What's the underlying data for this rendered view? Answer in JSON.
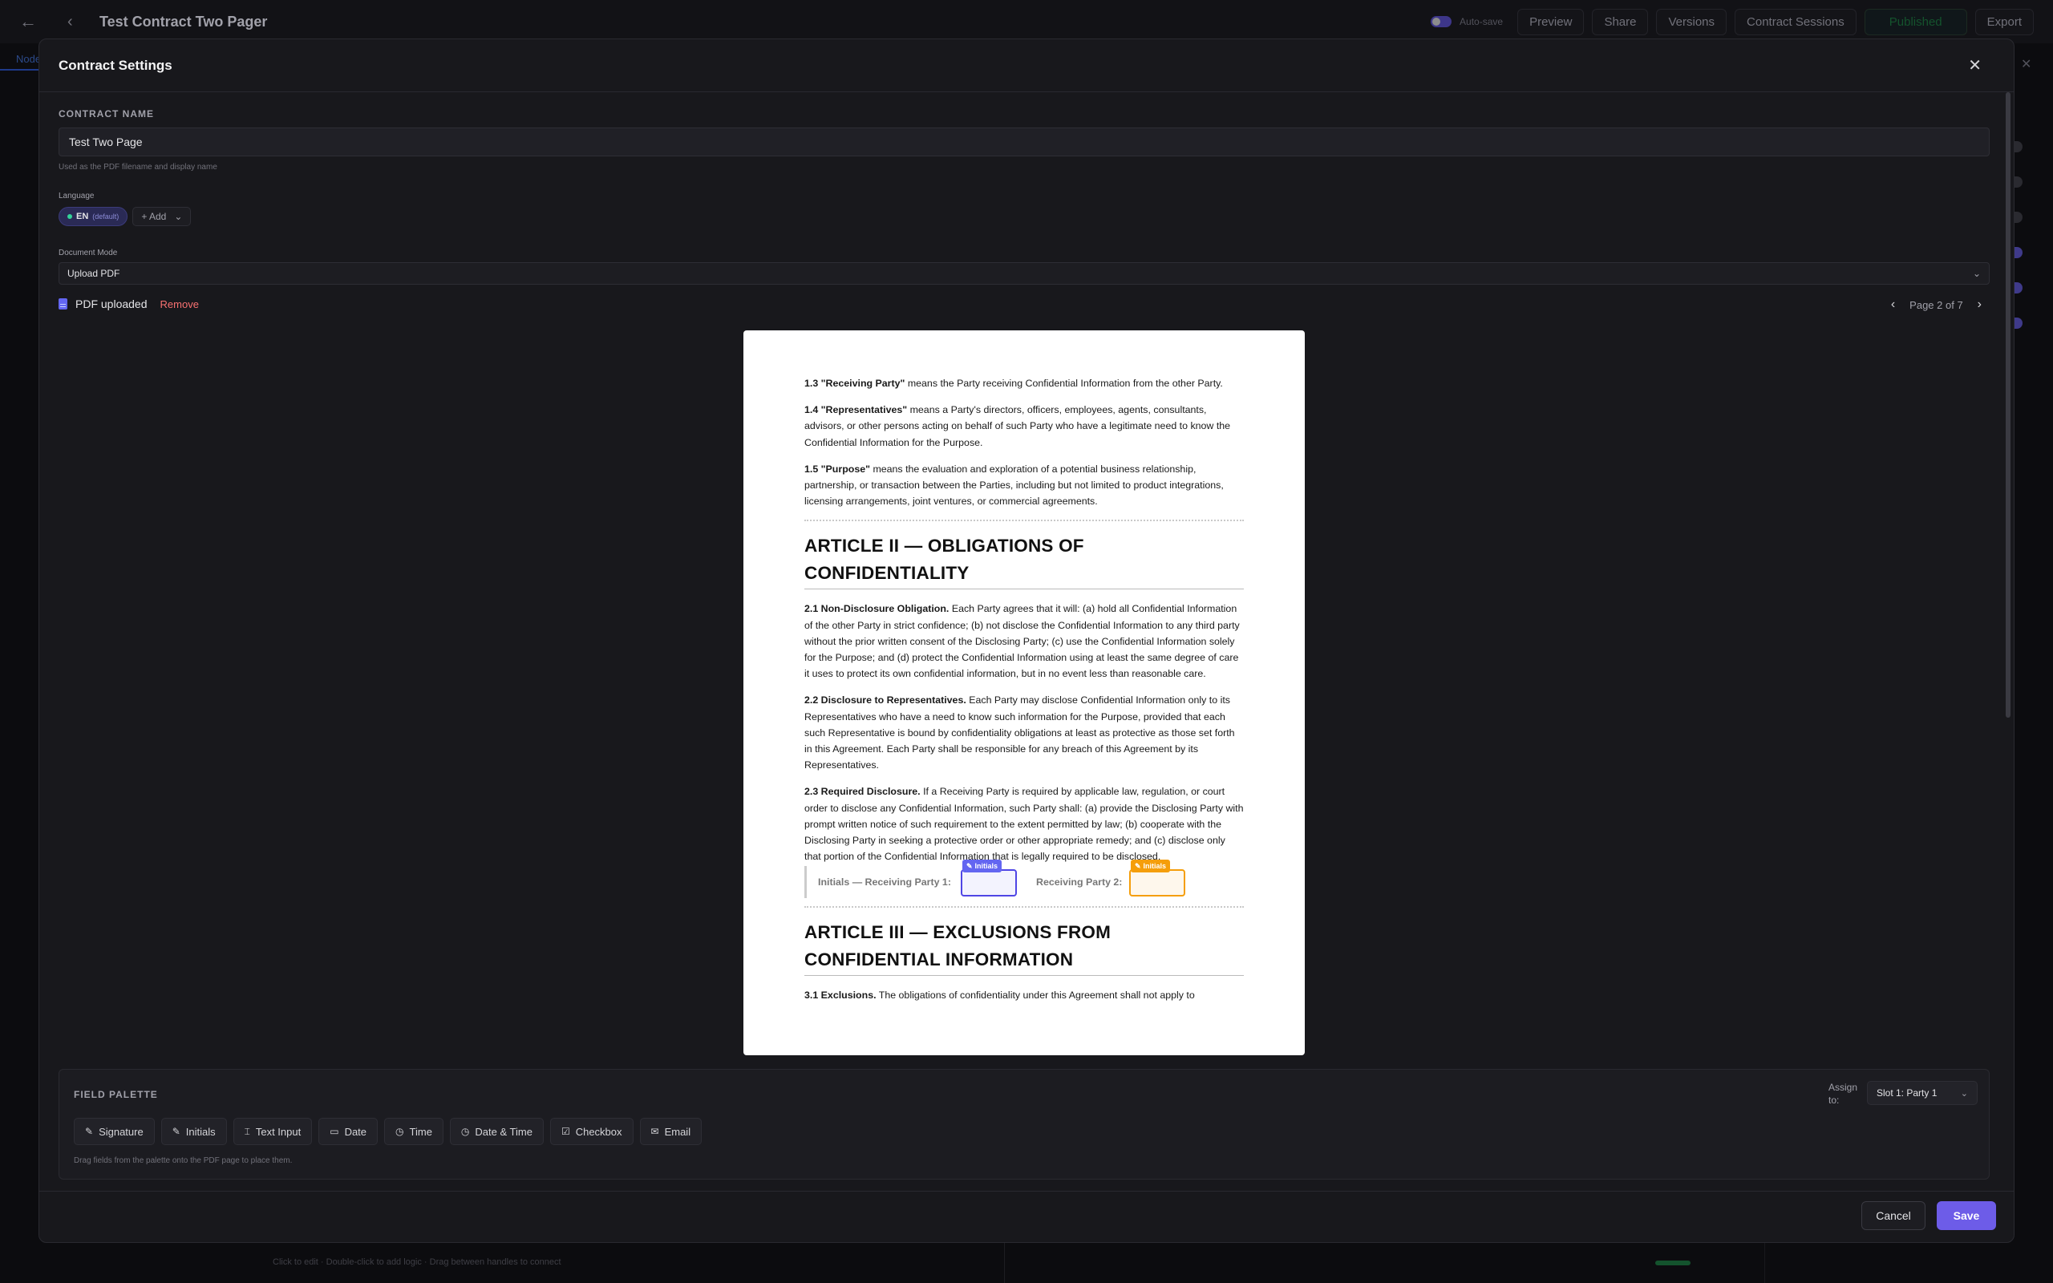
{
  "app": {
    "title": "Test Contract Two Pager",
    "autosave_label": "Auto-save",
    "toolbar": {
      "preview": "Preview",
      "share": "Share",
      "versions": "Versions",
      "contract_sessions": "Contract Sessions",
      "published": "Published",
      "export": "Export"
    },
    "bg_tab": "Node",
    "bg_hint": "Click to edit · Double-click to add logic · Drag between handles to connect"
  },
  "modal": {
    "title": "Contract Settings",
    "contract_name_label": "CONTRACT NAME",
    "contract_name_value": "Test Two Page",
    "contract_name_hint": "Used as the PDF filename and display name",
    "language_label": "Language",
    "language_chip": {
      "code": "EN",
      "default_label": "(default)"
    },
    "add_language": "+ Add",
    "document_mode_label": "Document Mode",
    "document_mode_value": "Upload PDF",
    "pdf_status": "PDF uploaded",
    "remove": "Remove",
    "pager": "Page 2 of 7",
    "cancel": "Cancel",
    "save": "Save"
  },
  "pdf_page": {
    "p13_term": "1.3 \"Receiving Party\"",
    "p13_text": " means the Party receiving Confidential Information from the other Party.",
    "p14_term": "1.4 \"Representatives\"",
    "p14_text": " means a Party's directors, officers, employees, agents, consultants, advisors, or other persons acting on behalf of such Party who have a legitimate need to know the Confidential Information for the Purpose.",
    "p15_term": "1.5 \"Purpose\"",
    "p15_text": " means the evaluation and exploration of a potential business relationship, partnership, or transaction between the Parties, including but not limited to product integrations, licensing arrangements, joint ventures, or commercial agreements.",
    "article2": "ARTICLE II — OBLIGATIONS OF CONFIDENTIALITY",
    "p21_term": "2.1 Non-Disclosure Obligation.",
    "p21_text": " Each Party agrees that it will: (a) hold all Confidential Information of the other Party in strict confidence; (b) not disclose the Confidential Information to any third party without the prior written consent of the Disclosing Party; (c) use the Confidential Information solely for the Purpose; and (d) protect the Confidential Information using at least the same degree of care it uses to protect its own confidential information, but in no event less than reasonable care.",
    "p22_term": "2.2 Disclosure to Representatives.",
    "p22_text": " Each Party may disclose Confidential Information only to its Representatives who have a need to know such information for the Purpose, provided that each such Representative is bound by confidentiality obligations at least as protective as those set forth in this Agreement. Each Party shall be responsible for any breach of this Agreement by its Representatives.",
    "p23_term": "2.3 Required Disclosure.",
    "p23_text": " If a Receiving Party is required by applicable law, regulation, or court order to disclose any Confidential Information, such Party shall: (a) provide the Disclosing Party with prompt written notice of such requirement to the extent permitted by law; (b) cooperate with the Disclosing Party in seeking a protective order or other appropriate remedy; and (c) disclose only that portion of the Confidential Information that is legally required to be disclosed.",
    "initials_label_1": "Initials — Receiving Party 1:",
    "initials_label_2": "Receiving Party 2:",
    "field_tag": "Initials",
    "article3": "ARTICLE III — EXCLUSIONS FROM CONFIDENTIAL INFORMATION",
    "p31_term": "3.1 Exclusions.",
    "p31_text": " The obligations of confidentiality under this Agreement shall not apply to"
  },
  "palette": {
    "title": "FIELD PALETTE",
    "buttons": [
      "Signature",
      "Initials",
      "Text Input",
      "Date",
      "Time",
      "Date & Time",
      "Checkbox",
      "Email"
    ],
    "hint": "Drag fields from the palette onto the PDF page to place them.",
    "assign_label": "Assign to:",
    "assign_value": "Slot 1: Party 1"
  },
  "colors": {
    "accent": "#6d5ce8",
    "party1": "#4f46e5",
    "party2": "#f59e0b",
    "danger": "#f87171"
  }
}
